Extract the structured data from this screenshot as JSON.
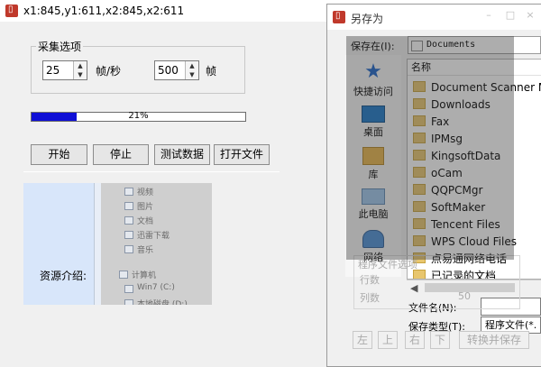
{
  "main": {
    "title": "x1:845,y1:611,x2:845,x2:611",
    "app_icon": "app-icon",
    "group_label": "采集选项",
    "fps_value": "25",
    "fps_unit": "帧/秒",
    "frames_value": "500",
    "frames_unit": "帧",
    "progress": {
      "percent": 21,
      "label": "21%",
      "fill_color": "#0f0fd6"
    },
    "buttons": {
      "start": "开始",
      "stop": "停止",
      "test": "测试数据",
      "open": "打开文件"
    },
    "intro_label": "资源介绍:",
    "preview_items": [
      "视频",
      "图片",
      "文档",
      "迅雷下载",
      "音乐",
      "计算机",
      "Win7 (C:)",
      "本地磁盘 (D:)"
    ]
  },
  "dialog": {
    "title": "另存为",
    "save_in_label": "保存在(I):",
    "save_in_value": "Documents",
    "places": [
      "快捷访问",
      "桌面",
      "库",
      "此电脑",
      "网络"
    ],
    "column_name": "名称",
    "files": [
      "Document Scanner Mana",
      "Downloads",
      "Fax",
      "IPMsg",
      "KingsoftData",
      "oCam",
      "QQPCMgr",
      "SoftMaker",
      "Tencent Files",
      "WPS Cloud Files",
      "点易通网络电话",
      "已记录的文档"
    ],
    "ghost_group": "程序文件选项",
    "ghost_rows": "行数",
    "ghost_cols": "列数",
    "ghost_value_1": "50",
    "ghost_value_2": "50",
    "filename_label": "文件名(N):",
    "filetype_label": "保存类型(T):",
    "filetype_value": "程序文件(*.",
    "nav_buttons": {
      "left": "左",
      "up": "上",
      "right": "右",
      "down": "下"
    },
    "convert_save": "转换并保存",
    "tb_minimize": "–",
    "tb_maximize": "□",
    "tb_close": "×"
  }
}
